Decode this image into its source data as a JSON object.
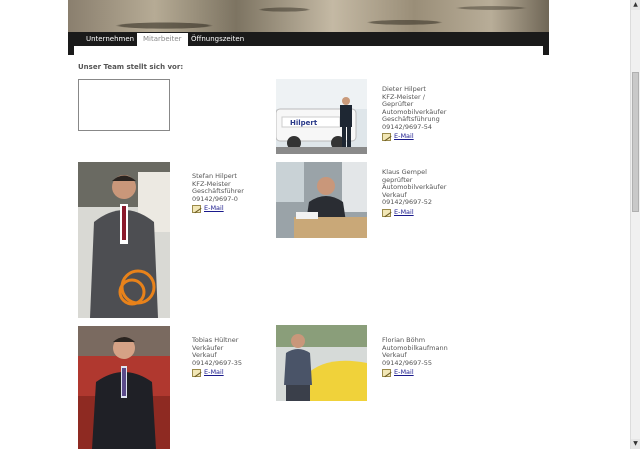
{
  "nav": {
    "tabs": [
      {
        "label": "Unternehmen"
      },
      {
        "label": "Mitarbeiter"
      },
      {
        "label": "Öffnungszeiten"
      }
    ]
  },
  "intro": "Unser Team stellt sich vor:",
  "mail_label": "E-Mail",
  "van_sign": "Hilpert",
  "people": [
    {
      "name": "Dieter Hilpert",
      "lines": [
        "KFZ-Meister /",
        "Geprüfter",
        "Automobilverkäufer",
        "Geschäftsführung",
        "09142/9697-54"
      ]
    },
    {
      "name": "Stefan Hilpert",
      "lines": [
        "KFZ-Meister",
        "Geschäftsführer",
        "09142/9697-0"
      ]
    },
    {
      "name": "Klaus Gempel",
      "lines": [
        "geprüfter",
        "Automobilverkäufer",
        "Verkauf",
        "09142/9697-52"
      ]
    },
    {
      "name": "Tobias Hültner",
      "lines": [
        "Verkäufer",
        "Verkauf",
        "09142/9697-35"
      ]
    },
    {
      "name": "Florian Böhm",
      "lines": [
        "Automobilkaufmann",
        "Verkauf",
        "09142/9697-55"
      ]
    }
  ]
}
